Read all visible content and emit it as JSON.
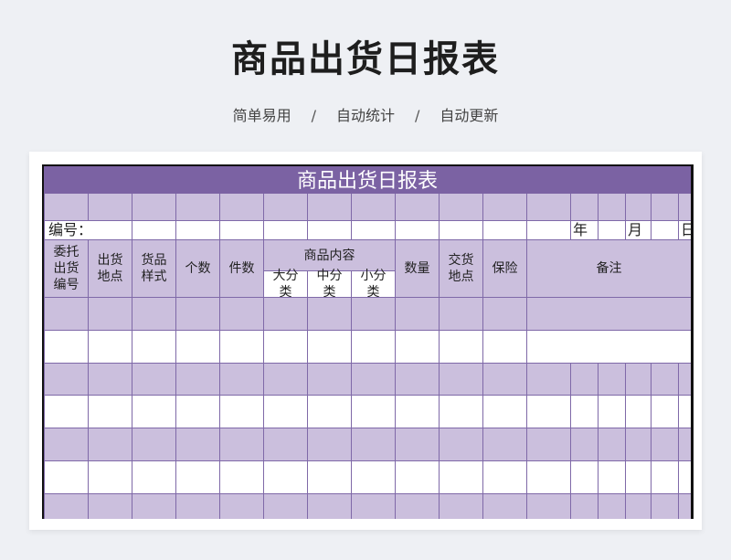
{
  "page": {
    "title": "商品出货日报表",
    "tags": [
      "简单易用",
      "自动统计",
      "自动更新"
    ],
    "separator": "/"
  },
  "sheet": {
    "title": "商品出货日报表",
    "number_label": "编号：",
    "year_label": "年",
    "month_label": "月",
    "day_label": "日",
    "headers": {
      "consignor_code": "委托出货编号",
      "ship_location": "出货地点",
      "goods_style": "货品样式",
      "count": "个数",
      "pieces": "件数",
      "goods_content": "商品内容",
      "major_category": "大分类",
      "mid_category": "中分类",
      "minor_category": "小分类",
      "quantity": "数量",
      "delivery_location": "交货地点",
      "insurance": "保险",
      "remarks": "备注"
    }
  },
  "colors": {
    "title_bar": "#7b62a3",
    "row_shade": "#cbbfdd",
    "grid_line": "#7f69a8"
  }
}
